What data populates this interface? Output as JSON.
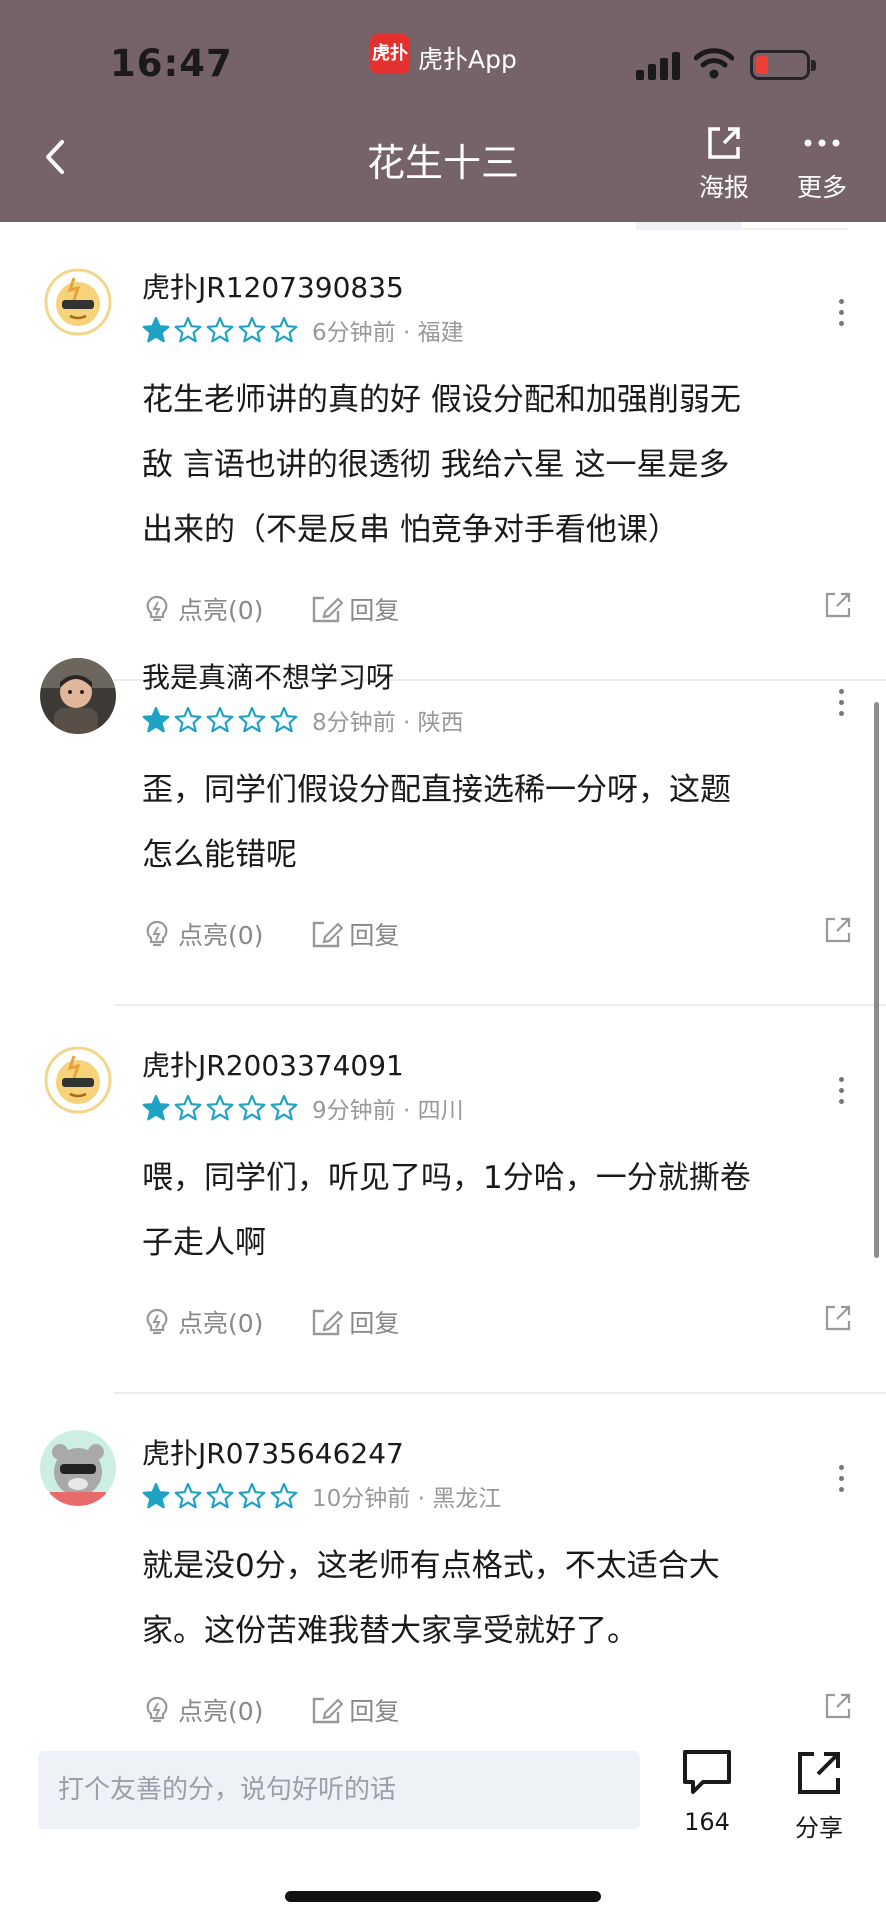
{
  "status_bar": {
    "time": "16:47",
    "app_logo_text": "虎扑",
    "app_name": "虎扑App"
  },
  "nav": {
    "title": "花生十三",
    "poster_label": "海报",
    "more_label": "更多"
  },
  "comments": [
    {
      "username": "虎扑JR1207390835",
      "rating": 1,
      "max_rating": 5,
      "meta": "6分钟前 · 福建",
      "lines": [
        "花生老师讲的真的好 假设分配和加强削弱无",
        "敌 言语也讲的很透彻 我给六星 这一星是多",
        "出来的（不是反串 怕竞争对手看他课）"
      ],
      "like_label": "点亮(0)",
      "reply_label": "回复",
      "avatar": "tiger-sunglasses-icon"
    },
    {
      "username": "我是真滴不想学习呀",
      "rating": 1,
      "max_rating": 5,
      "meta": "8分钟前 · 陕西",
      "lines": [
        "歪，同学们假设分配直接选稀一分呀，这题",
        "怎么能错呢"
      ],
      "like_label": "点亮(0)",
      "reply_label": "回复",
      "avatar": "child-photo"
    },
    {
      "username": "虎扑JR2003374091",
      "rating": 1,
      "max_rating": 5,
      "meta": "9分钟前 · 四川",
      "lines": [
        "喂，同学们，听见了吗，1分哈，一分就撕卷",
        "子走人啊"
      ],
      "like_label": "点亮(0)",
      "reply_label": "回复",
      "avatar": "tiger-sunglasses-icon"
    },
    {
      "username": "虎扑JR0735646247",
      "rating": 1,
      "max_rating": 5,
      "meta": "10分钟前 · 黑龙江",
      "lines": [
        "就是没0分，这老师有点格式，不太适合大",
        "家。这份苦难我替大家享受就好了。"
      ],
      "like_label": "点亮(0)",
      "reply_label": "回复",
      "avatar": "bear-sunglasses-icon"
    }
  ],
  "bottom_bar": {
    "placeholder": "打个友善的分，说句好听的话",
    "comment_count": "164",
    "share_label": "分享"
  },
  "colors": {
    "header": "#76636a",
    "star": "#1fa3c4",
    "meta": "#999999",
    "logo": "#e4312f"
  }
}
